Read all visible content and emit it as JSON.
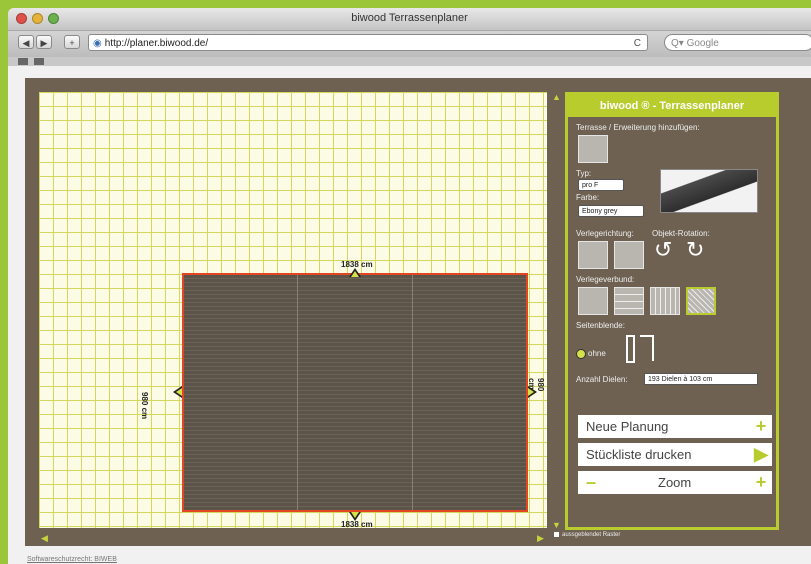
{
  "window": {
    "title": "biwood Terrassenplaner"
  },
  "browser": {
    "back": "◀",
    "forward": "▶",
    "add": "+",
    "url": "http://planer.biwood.de/",
    "reload": "C",
    "search_placeholder": "Q▾ Google"
  },
  "canvas": {
    "dim_top": "1838 cm",
    "dim_bottom": "1838 cm",
    "dim_left": "980 cm",
    "dim_right": "980 cm"
  },
  "panel": {
    "title": "biwood ® - Terrassenplaner",
    "add_label": "Terrasse / Erweiterung hinzufügen:",
    "typ_label": "Typ:",
    "typ_value": "pro F",
    "farbe_label": "Farbe:",
    "farbe_value": "Ebony grey",
    "verlegerichtung_label": "Verlegerichtung:",
    "objekt_rotation_label": "Objekt-Rotation:",
    "verlegeverbund_label": "Verlegeverbund:",
    "seitenblende_label": "Seitenblende:",
    "ohne_label": "ohne",
    "anzahl_label": "Anzahl Dielen:",
    "anzahl_value": "193 Dielen à 103 cm",
    "buttons": {
      "neue_planung": "Neue Planung",
      "stueckliste": "Stückliste drucken",
      "zoom": "Zoom"
    },
    "rotate_left": "↺",
    "rotate_right": "↻",
    "icon_plus": "+",
    "icon_play": "▶",
    "icon_minus": "–"
  },
  "footer": {
    "link": "Softwareschutzrecht: BIWEB",
    "checkbox_label": "aussgeblendet Raster"
  },
  "colors": {
    "accent": "#b8cc2e",
    "background": "#6e6152",
    "outline": "#e24622"
  }
}
